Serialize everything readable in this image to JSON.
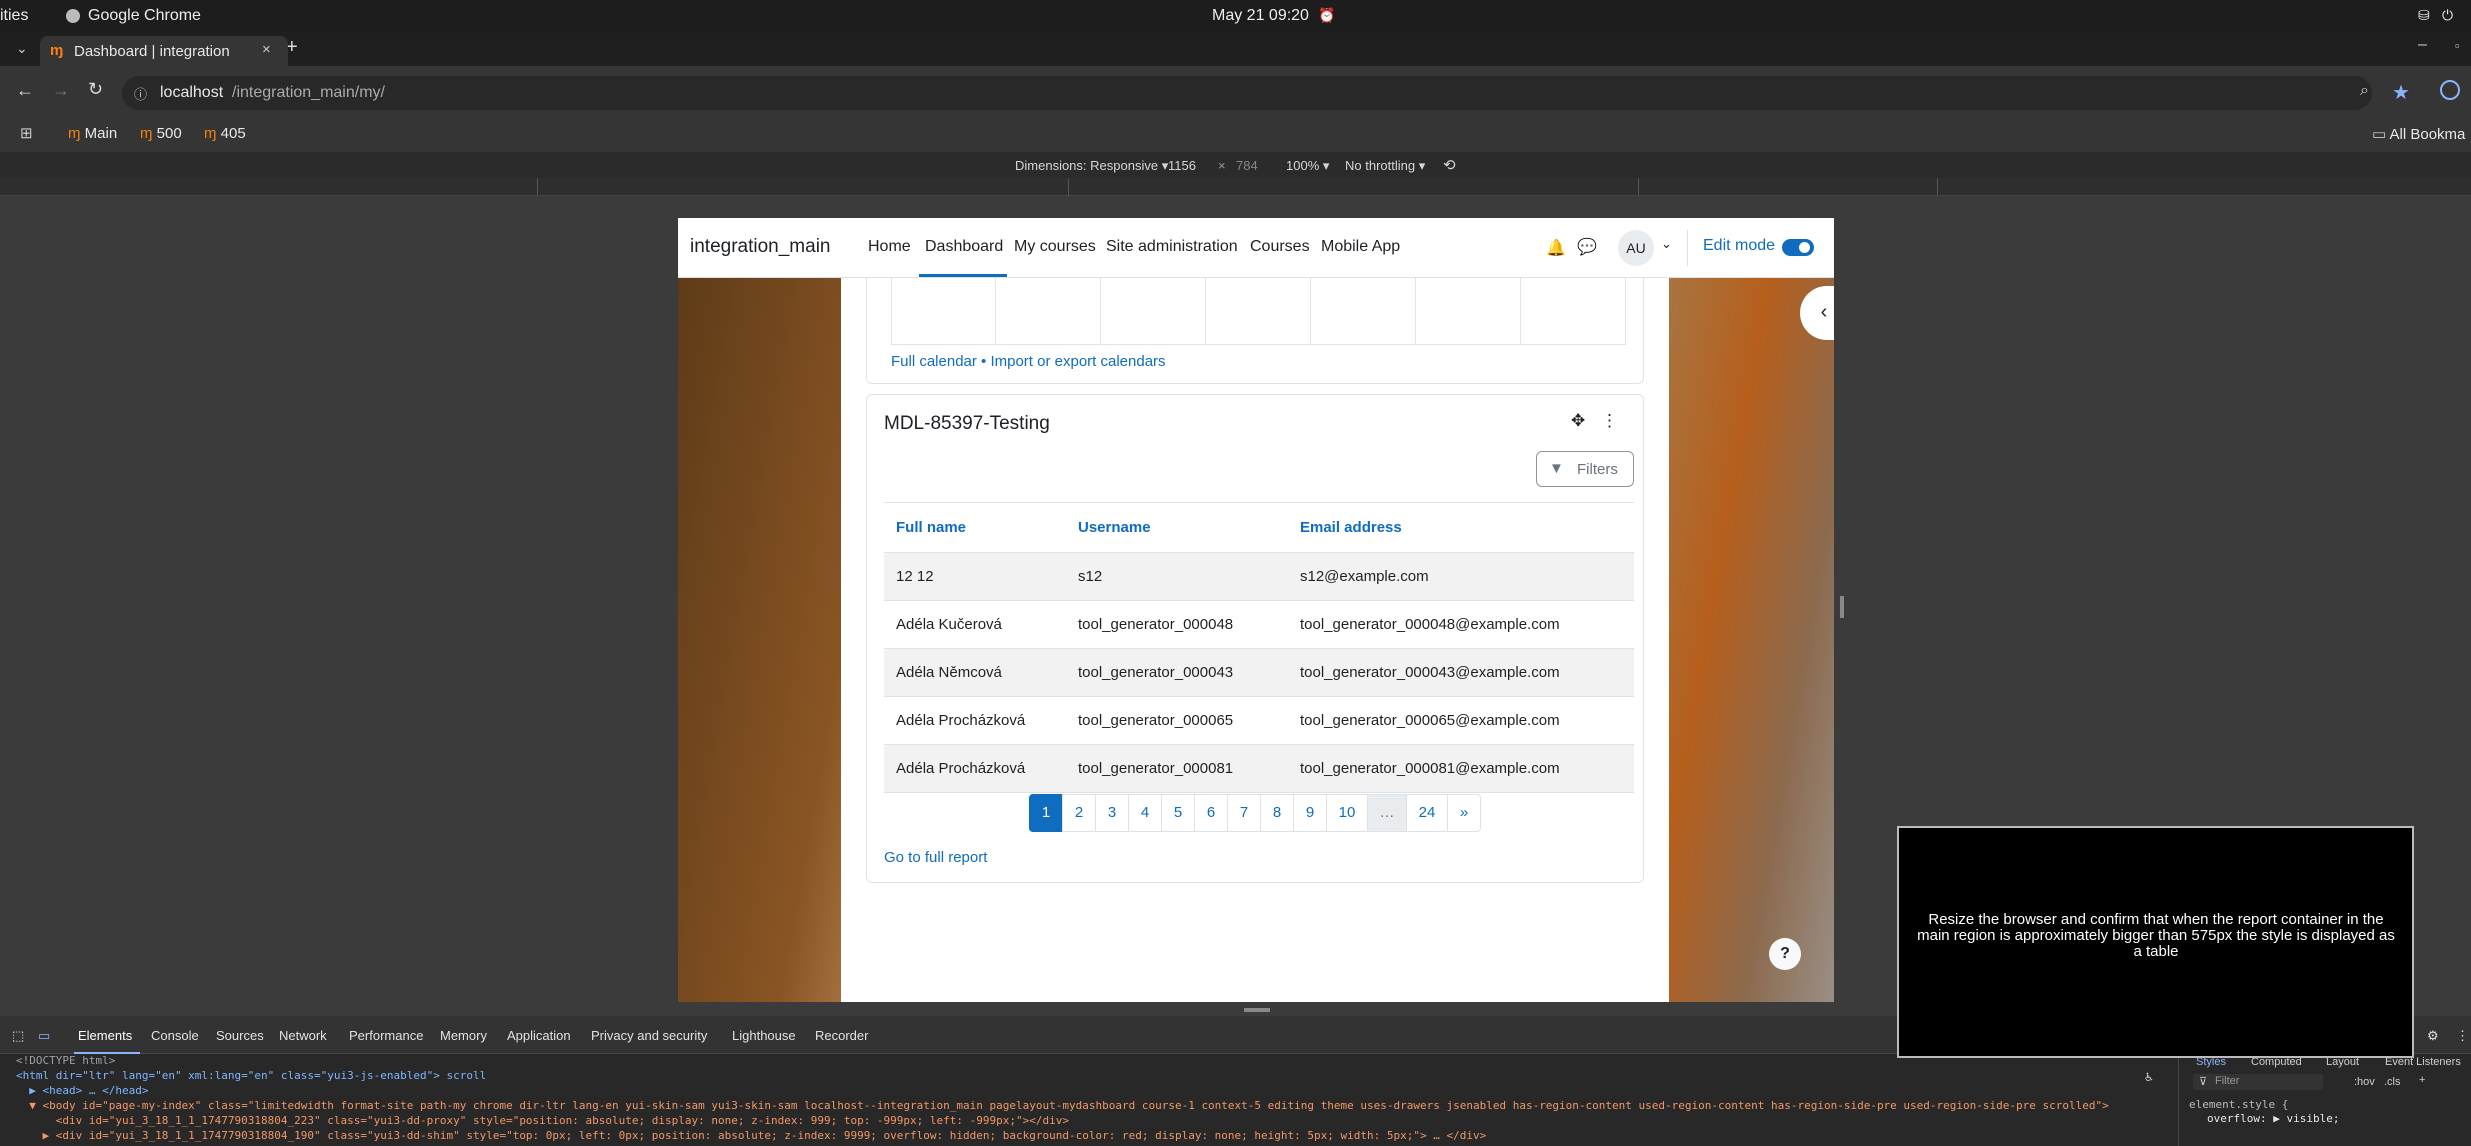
{
  "os": {
    "activities": "ities",
    "app_name": "Google Chrome",
    "clock": "May 21  09:20"
  },
  "browser": {
    "tab_title": "Dashboard | integration",
    "url_host": "localhost",
    "url_path": "/integration_main/my/",
    "bookmarks": [
      "Main",
      "500",
      "405"
    ],
    "all_bookmarks": "All Bookma"
  },
  "device_toolbar": {
    "dimensions_label": "Dimensions: Responsive",
    "width": "1156",
    "height": "784",
    "zoom": "100%",
    "throttling": "No throttling"
  },
  "site": {
    "brand": "integration_main",
    "nav": [
      "Home",
      "Dashboard",
      "My courses",
      "Site administration",
      "Courses",
      "Mobile App"
    ],
    "active_nav": "Dashboard",
    "avatar": "AU",
    "edit_mode_label": "Edit mode",
    "edit_mode_on": true
  },
  "calendar": {
    "footer_link": "Full calendar • Import or export calendars"
  },
  "report": {
    "title": "MDL-85397-Testing",
    "filters_label": "Filters",
    "columns": [
      "Full name",
      "Username",
      "Email address"
    ],
    "rows": [
      [
        "12 12",
        "s12",
        "s12@example.com"
      ],
      [
        "Adéla Kučerová",
        "tool_generator_000048",
        "tool_generator_000048@example.com"
      ],
      [
        "Adéla Němcová",
        "tool_generator_000043",
        "tool_generator_000043@example.com"
      ],
      [
        "Adéla Procházková",
        "tool_generator_000065",
        "tool_generator_000065@example.com"
      ],
      [
        "Adéla Procházková",
        "tool_generator_000081",
        "tool_generator_000081@example.com"
      ]
    ],
    "pagination": [
      "1",
      "2",
      "3",
      "4",
      "5",
      "6",
      "7",
      "8",
      "9",
      "10",
      "…",
      "24",
      "»"
    ],
    "current_page": "1",
    "full_report_link": "Go to full report"
  },
  "devtools": {
    "tabs": [
      "Elements",
      "Console",
      "Sources",
      "Network",
      "Performance",
      "Memory",
      "Application",
      "Privacy and security",
      "Lighthouse",
      "Recorder"
    ],
    "active_tab": "Elements",
    "code_lines": [
      "<!DOCTYPE html>",
      "<html dir=\"ltr\" lang=\"en\" xml:lang=\"en\" class=\"yui3-js-enabled\"> scroll",
      "  ▶ <head> … </head>",
      "  ▼ <body id=\"page-my-index\" class=\"limitedwidth format-site path-my chrome dir-ltr lang-en yui-skin-sam yui3-skin-sam localhost--integration_main pagelayout-mydashboard course-1 context-5 editing theme uses-drawers jsenabled has-region-content used-region-content has-region-side-pre used-region-side-pre scrolled\">",
      "      <div id=\"yui_3_18_1_1_1747790318804_223\" class=\"yui3-dd-proxy\" style=\"position: absolute; display: none; z-index: 999; top: -999px; left: -999px;\"></div>",
      "    ▶ <div id=\"yui_3_18_1_1_1747790318804_190\" class=\"yui3-dd-shim\" style=\"top: 0px; left: 0px; position: absolute; z-index: 9999; overflow: hidden; background-color: red; display: none; height: 5px; width: 5px;\"> … </div>"
    ],
    "styles_tabs": [
      "Styles",
      "Computed",
      "Layout",
      "Event Listeners"
    ],
    "filter_placeholder": "Filter",
    "hov": ":hov",
    "cls": ".cls",
    "element_style": "element.style {",
    "overflow_rule": "overflow: ▶ visible;"
  },
  "instruction": "Resize the browser and confirm that when the report container in the main region is approximately bigger than 575px the style is displayed as a table"
}
